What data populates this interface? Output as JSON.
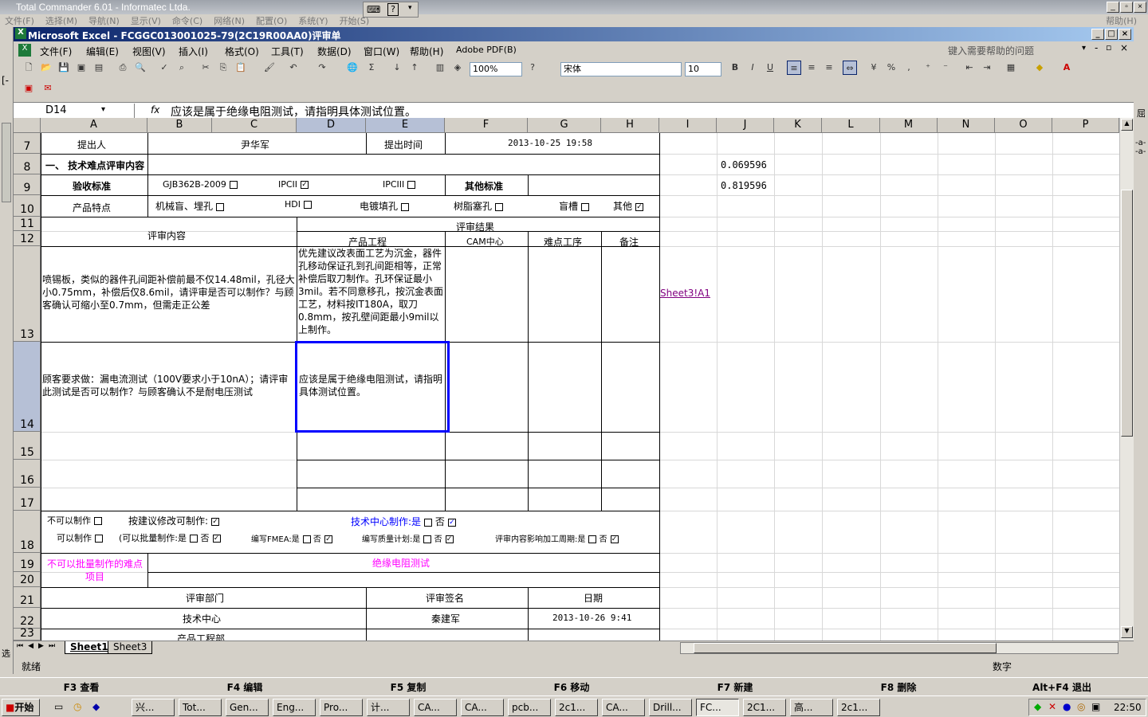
{
  "tc": {
    "title": "Total Commander 6.01 - Informatec Ltda.",
    "menu": [
      "文件(F)",
      "选择(M)",
      "导航(N)",
      "显示(V)",
      "命令(C)",
      "网络(N)",
      "配置(O)",
      "系统(Y)",
      "开始(S)"
    ],
    "help": "帮助(H)",
    "left_label": "选"
  },
  "excel": {
    "title": "Microsoft Excel - FCGGC013001025-79(2C19R00AA0)评审单",
    "menu": [
      "文件(F)",
      "编辑(E)",
      "视图(V)",
      "插入(I)",
      "格式(O)",
      "工具(T)",
      "数据(D)",
      "窗口(W)",
      "帮助(H)",
      "Adobe PDF(B)"
    ],
    "help_placeholder": "键入需要帮助的问题",
    "zoom": "100%",
    "font": "宋体",
    "font_size": "10",
    "name_box": "D14",
    "fx": "fx",
    "formula": "应该是属于绝缘电阻测试，请指明具体测试位置。",
    "columns": [
      "A",
      "B",
      "C",
      "D",
      "E",
      "F",
      "G",
      "H",
      "I",
      "J",
      "K",
      "L",
      "M",
      "N",
      "O",
      "P"
    ],
    "rows": [
      "7",
      "8",
      "9",
      "10",
      "11",
      "12",
      "13",
      "14",
      "15",
      "16",
      "17",
      "18",
      "19",
      "20",
      "21",
      "22",
      "23"
    ],
    "sheets": [
      "Sheet1",
      "Sheet3"
    ],
    "status_left": "就绪",
    "status_right": "数字"
  },
  "cells": {
    "r7_proposer_label": "提出人",
    "r7_proposer": "尹华军",
    "r7_time_label": "提出时间",
    "r7_time": "2013-10-25 19:58",
    "r8_section": "一、 技术难点评审内容",
    "r8_j": "0.069596",
    "r9_acc_label": "验收标准",
    "r9_gjb": "GJB362B-2009",
    "r9_ipcii": "IPCII",
    "r9_ipciii": "IPCIII",
    "r9_other_label": "其他标准",
    "r9_j": "0.819596",
    "r10_label": "产品特点",
    "r10_opt1": "机械盲、埋孔",
    "r10_opt2": "HDI",
    "r10_opt3": "电镀填孔",
    "r10_opt4": "树脂塞孔",
    "r10_opt5": "盲槽",
    "r10_opt6": "其他",
    "r11_content": "评审内容",
    "r11_result": "评审结果",
    "r12_d": "产品工程",
    "r12_f": "CAM中心",
    "r12_g": "难点工序",
    "r12_h": "备注",
    "r13_a": "喷锡板，类似的器件孔间距补偿前最不仅14.48mil，孔径大小0.75mm，补偿后仅8.6mil，请评审是否可以制作？与顾客确认可缩小至0.7mm，但需走正公差",
    "r13_d": "优先建议改表面工艺为沉金，器件孔移动保证孔到孔间距相等，正常补偿后取刀制作。孔环保证最小3mil。若不同意移孔，按沉金表面工艺，材料按IT180A，取刀0.8mm，按孔壁间距最小9mil以上制作。",
    "r13_link": "Sheet3!A1",
    "r14_a": "顾客要求做：漏电流测试（100V要求小于10nA）；请评审此测试是否可以制作？与顾客确认不是耐电压测试",
    "r14_d": "应该是属于绝缘电阻测试，请指明具体测试位置。",
    "r18_l1a": "不可以制作",
    "r18_l1b": "按建议修改可制作:",
    "r18_l1c": "技术中心制作:是",
    "r18_l1d": "否",
    "r18_l2a": "可以制作",
    "r18_l2b": "(可以批量制作:是",
    "r18_l2c": "否",
    "r18_l2d": "编写FMEA:是",
    "r18_l2e": "否",
    "r18_l2f": "编写质量计划:是",
    "r18_l2g": "否",
    "r18_l2h": "评审内容影响加工周期:是",
    "r18_l2i": "否",
    "r19_label": "不可以批量制作的难点项目",
    "r19_value": "绝缘电阻测试",
    "r21_dept": "评审部门",
    "r21_sign": "评审签名",
    "r21_date": "日期",
    "r22_dept": "技术中心",
    "r22_sign": "秦建军",
    "r22_date": "2013-10-26 9:41",
    "r23_dept": "产品工程部"
  },
  "fkeys": [
    "F3 查看",
    "F4 编辑",
    "F5 复制",
    "F6 移动",
    "F7 新建",
    "F8 删除",
    "Alt+F4 退出"
  ],
  "taskbar": {
    "start": "开始",
    "items": [
      "兴...",
      "Tot...",
      "Gen...",
      "Eng...",
      "Pro...",
      "计...",
      "CA...",
      "CA...",
      "pcb...",
      "2c1...",
      "CA...",
      "Drill...",
      "FC...",
      "2C1...",
      "高...",
      "2c1..."
    ],
    "clock": "22:50"
  }
}
